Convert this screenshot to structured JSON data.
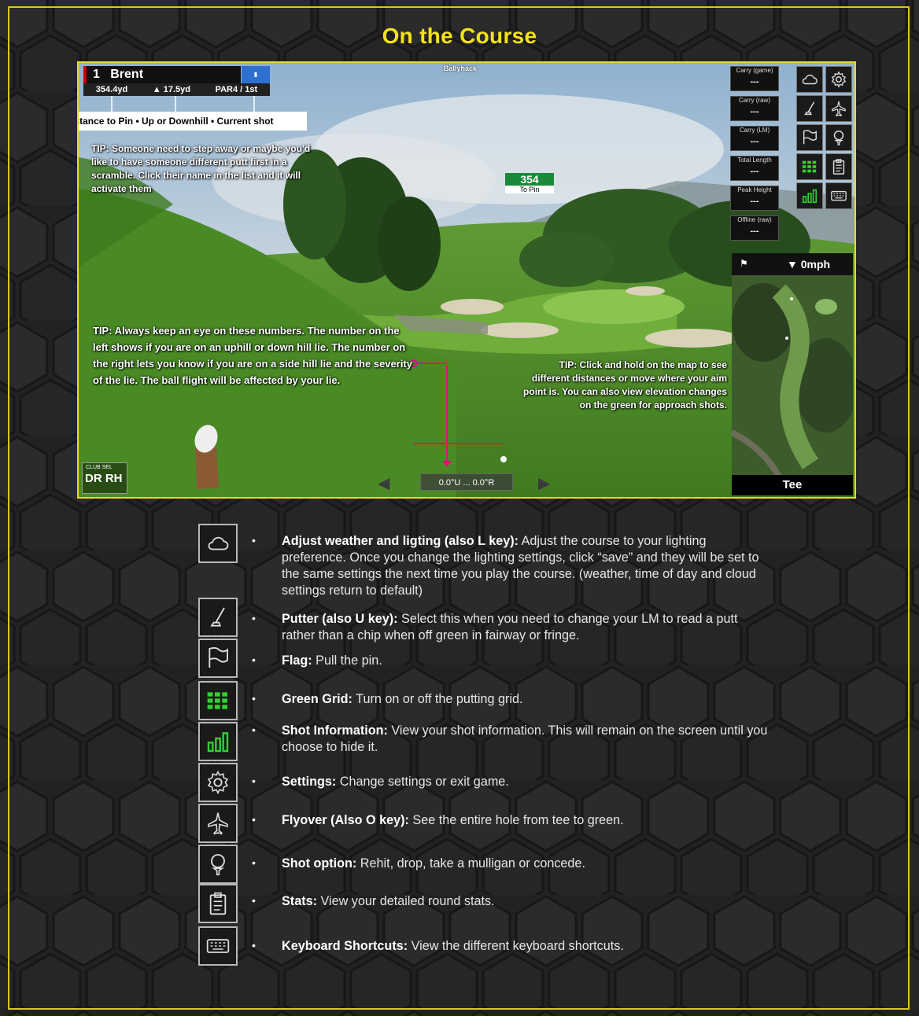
{
  "page": {
    "title": "On the Course"
  },
  "hud": {
    "player_number": "1",
    "player_name": "Brent",
    "distance": "354.4yd",
    "elevation": "▲ 17.5yd",
    "par_shot": "PAR4 / 1st",
    "callout": "Distance to Pin • Up or Downhill • Current shot",
    "course_name": "Ballyhack"
  },
  "tips": {
    "tip1": "TIP: Someone need to step away or maybe you'd like to have someone different putt first in a scramble. Click their name in the list and it will activate them",
    "tip2": "TIP: Always keep an eye on these numbers. The number on the left shows if you are on an uphill or down hill lie. The number on the right lets you know if you are on a side hill lie and the severity of the lie. The ball flight will be affected by your lie.",
    "tip3": "TIP: Click and hold on the map to see different distances or move where your aim point is. You can also view elevation changes on the green for approach shots."
  },
  "pin_marker": {
    "distance": "354",
    "label": "To Pin"
  },
  "stat_boxes": [
    {
      "label": "Carry (game)",
      "value": "---"
    },
    {
      "label": "Carry (raw)",
      "value": "---"
    },
    {
      "label": "Carry (LM)",
      "value": "---"
    },
    {
      "label": "Total Length",
      "value": "---"
    },
    {
      "label": "Peak Height",
      "value": "---"
    },
    {
      "label": "Offline (raw)",
      "value": "---"
    }
  ],
  "wind": {
    "speed": "0mph"
  },
  "map": {
    "location": "Tee"
  },
  "club_select": {
    "label": "CLUB SEL",
    "value": "DR RH"
  },
  "lie": {
    "value": "0.0°U ... 0.0°R"
  },
  "legend": [
    {
      "icon": "cloud-icon",
      "title": "Adjust weather and ligting (also L key):",
      "desc": " Adjust the course to your lighting preference. Once you change the lighting settings, click “save” and they will be set to the same settings the next time you play the course. (weather, time of day and cloud settings return to default)"
    },
    {
      "icon": "putter-icon",
      "title": "Putter (also U key):",
      "desc": " Select this when you need to change your LM to read a putt rather than a chip when off green in fairway or fringe."
    },
    {
      "icon": "flag-icon",
      "title": "Flag:",
      "desc": " Pull the pin."
    },
    {
      "icon": "green-grid-icon",
      "title": "Green Grid:",
      "desc": " Turn on or off the putting grid."
    },
    {
      "icon": "shot-info-icon",
      "title": "Shot Information:",
      "desc": " View your shot information. This will remain on the screen until you choose to hide it."
    },
    {
      "icon": "gear-icon",
      "title": "Settings:",
      "desc": " Change settings or exit game."
    },
    {
      "icon": "airplane-icon",
      "title": "Flyover (Also O key):",
      "desc": " See the entire hole from tee to green."
    },
    {
      "icon": "golf-ball-tee-icon",
      "title": "Shot option:",
      "desc": " Rehit, drop, take a mulligan or concede."
    },
    {
      "icon": "clipboard-icon",
      "title": "Stats:",
      "desc": " View your detailed round stats."
    },
    {
      "icon": "keyboard-icon",
      "title": "Keyboard Shortcuts:",
      "desc": " View the different keyboard shortcuts."
    }
  ],
  "colors": {
    "accent": "#f2e21a",
    "frame": "#d8c81a",
    "callout_line": "#d6157a",
    "grass": "#4e8b2a",
    "sky": "#b9cfe0"
  }
}
